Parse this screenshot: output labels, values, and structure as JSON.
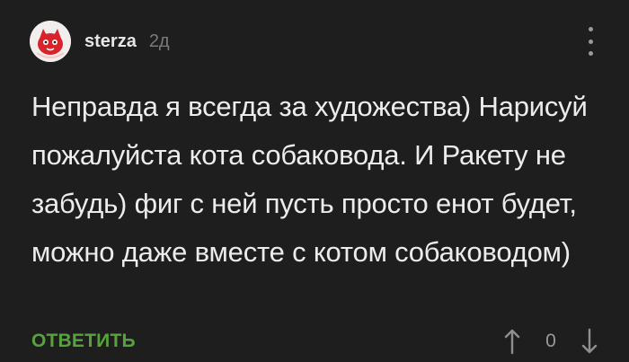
{
  "comment": {
    "author": "sterza",
    "time_ago": "2д",
    "text": "Неправда я всегда за художества) Нарисуй пожалуйста кота собаковода. И Ракету не забудь) фиг с ней пусть просто енот будет, можно даже вместе с котом собаководом)",
    "reply_label": "ОТВЕТИТЬ",
    "score": "0"
  },
  "colors": {
    "background": "#1e1e1e",
    "text": "#ececec",
    "accent": "#56a33b",
    "muted": "#7a7a7a",
    "avatar_red": "#d9232b"
  },
  "icons": {
    "menu": "more-vertical-icon",
    "upvote": "arrow-up-icon",
    "downvote": "arrow-down-icon"
  }
}
